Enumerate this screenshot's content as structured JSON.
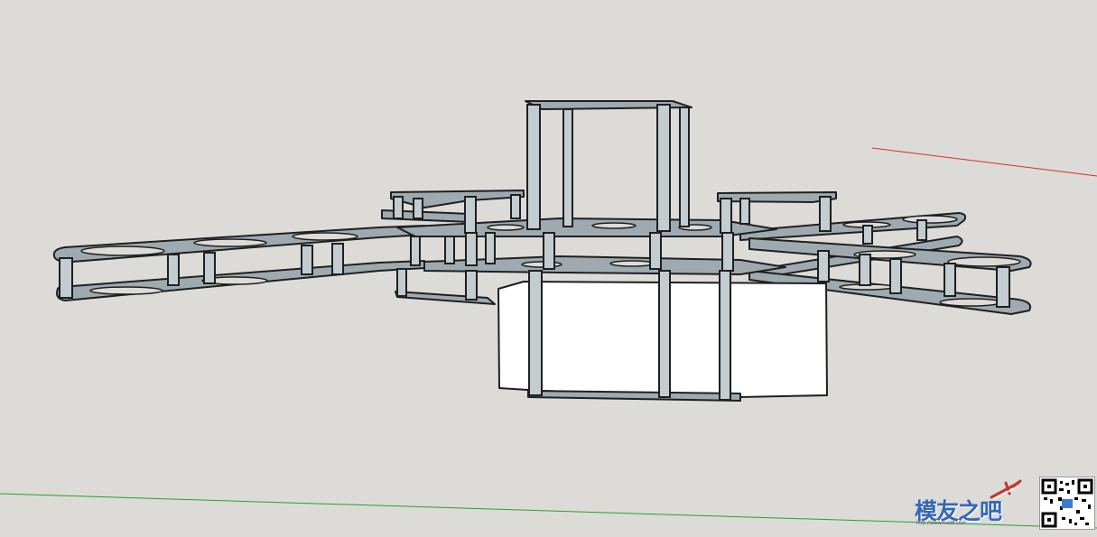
{
  "scene": {
    "background": "#dcdbd7",
    "model": "drone-frame",
    "colors": {
      "frame_fill": "#9faab0",
      "frame_stroke": "#1e1f20",
      "standoff_fill": "#c3ccd1",
      "battery_fill": "#ffffff",
      "axis_red": "#d9302c",
      "axis_green": "#2f9e2f"
    }
  },
  "watermark": {
    "logo_text": "模友之吧",
    "url": "http://www.moz8.com",
    "icons": [
      "airplane-icon",
      "qr-code-icon"
    ]
  }
}
